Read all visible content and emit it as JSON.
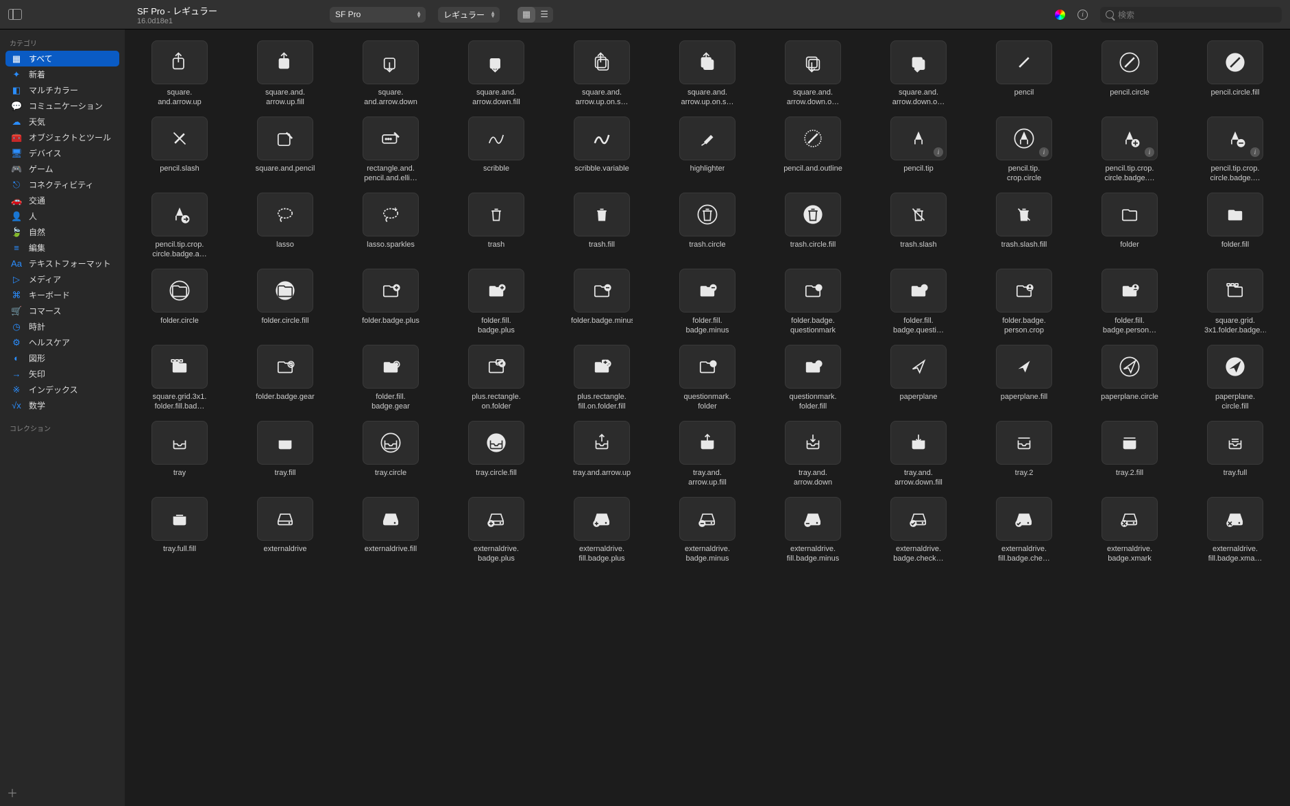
{
  "header": {
    "title": "SF Pro - レギュラー",
    "subtitle": "16.0d18e1",
    "font_select": "SF Pro",
    "weight_select": "レギュラー",
    "search_placeholder": "検索"
  },
  "sidebar": {
    "section_categories": "カテゴリ",
    "section_collections": "コレクション",
    "items": [
      {
        "icon": "grid",
        "label": "すべて",
        "active": true
      },
      {
        "icon": "sparkle",
        "label": "新着"
      },
      {
        "icon": "palette",
        "label": "マルチカラー"
      },
      {
        "icon": "bubble",
        "label": "コミュニケーション"
      },
      {
        "icon": "cloud",
        "label": "天気"
      },
      {
        "icon": "briefcase",
        "label": "オブジェクトとツール"
      },
      {
        "icon": "display",
        "label": "デバイス"
      },
      {
        "icon": "gamepad",
        "label": "ゲーム"
      },
      {
        "icon": "wifi",
        "label": "コネクティビティ"
      },
      {
        "icon": "car",
        "label": "交通"
      },
      {
        "icon": "person",
        "label": "人"
      },
      {
        "icon": "leaf",
        "label": "自然"
      },
      {
        "icon": "lines",
        "label": "編集"
      },
      {
        "icon": "Aa",
        "label": "テキストフォーマット"
      },
      {
        "icon": "play",
        "label": "メディア"
      },
      {
        "icon": "keyboard",
        "label": "キーボード"
      },
      {
        "icon": "cart",
        "label": "コマース"
      },
      {
        "icon": "clock",
        "label": "時計"
      },
      {
        "icon": "gear",
        "label": "ヘルスケア"
      },
      {
        "icon": "shapes",
        "label": "図形"
      },
      {
        "icon": "arrow",
        "label": "矢印"
      },
      {
        "icon": "index",
        "label": "インデックス"
      },
      {
        "icon": "math",
        "label": "数学"
      }
    ]
  },
  "symbols": [
    {
      "name": "square.and.arrow.up",
      "g": "share"
    },
    {
      "name": "square.and.arrow.up.fill",
      "g": "share-fill"
    },
    {
      "name": "square.and.arrow.down",
      "g": "import"
    },
    {
      "name": "square.and.arrow.down.fill",
      "g": "import-fill"
    },
    {
      "name": "square.and.arrow.up.on.s…",
      "g": "share-multi"
    },
    {
      "name": "square.and.arrow.up.on.s…",
      "g": "share-multi-fill"
    },
    {
      "name": "square.and.arrow.down.o…",
      "g": "import-multi"
    },
    {
      "name": "square.and.arrow.down.o…",
      "g": "import-multi-fill"
    },
    {
      "name": "pencil",
      "g": "pencil"
    },
    {
      "name": "pencil.circle",
      "g": "pencil-circle"
    },
    {
      "name": "pencil.circle.fill",
      "g": "pencil-circle-fill"
    },
    {
      "name": "pencil.slash",
      "g": "pencil-slash"
    },
    {
      "name": "square.and.pencil",
      "g": "compose"
    },
    {
      "name": "rectangle.and.pencil.and.elli…",
      "g": "rect-pencil"
    },
    {
      "name": "scribble",
      "g": "scribble"
    },
    {
      "name": "scribble.variable",
      "g": "scribble-var"
    },
    {
      "name": "highlighter",
      "g": "highlighter"
    },
    {
      "name": "pencil.and.outline",
      "g": "pencil-outline"
    },
    {
      "name": "pencil.tip",
      "g": "pencil-tip",
      "info": true
    },
    {
      "name": "pencil.tip.crop.circle",
      "g": "pencil-tip-circle",
      "info": true
    },
    {
      "name": "pencil.tip.crop.circle.badge.…",
      "g": "pencil-tip-badge-plus",
      "info": true
    },
    {
      "name": "pencil.tip.crop.circle.badge.…",
      "g": "pencil-tip-badge-minus",
      "info": true
    },
    {
      "name": "pencil.tip.crop.circle.badge.a…",
      "g": "pencil-tip-badge-arrow"
    },
    {
      "name": "lasso",
      "g": "lasso"
    },
    {
      "name": "lasso.sparkles",
      "g": "lasso-sparkles"
    },
    {
      "name": "trash",
      "g": "trash"
    },
    {
      "name": "trash.fill",
      "g": "trash-fill"
    },
    {
      "name": "trash.circle",
      "g": "trash-circle"
    },
    {
      "name": "trash.circle.fill",
      "g": "trash-circle-fill"
    },
    {
      "name": "trash.slash",
      "g": "trash-slash"
    },
    {
      "name": "trash.slash.fill",
      "g": "trash-slash-fill"
    },
    {
      "name": "folder",
      "g": "folder"
    },
    {
      "name": "folder.fill",
      "g": "folder-fill"
    },
    {
      "name": "folder.circle",
      "g": "folder-circle"
    },
    {
      "name": "folder.circle.fill",
      "g": "folder-circle-fill"
    },
    {
      "name": "folder.badge.plus",
      "g": "folder-plus"
    },
    {
      "name": "folder.fill.badge.plus",
      "g": "folder-fill-plus"
    },
    {
      "name": "folder.badge.minus",
      "g": "folder-minus"
    },
    {
      "name": "folder.fill.badge.minus",
      "g": "folder-fill-minus"
    },
    {
      "name": "folder.badge.questionmark",
      "g": "folder-q"
    },
    {
      "name": "folder.fill.badge.questi…",
      "g": "folder-fill-q"
    },
    {
      "name": "folder.badge.person.crop",
      "g": "folder-person"
    },
    {
      "name": "folder.fill.badge.person…",
      "g": "folder-fill-person"
    },
    {
      "name": "square.grid.3x1.folder.badge.…",
      "g": "grid-folder"
    },
    {
      "name": "square.grid.3x1.folder.fill.bad…",
      "g": "grid-folder-fill"
    },
    {
      "name": "folder.badge.gear",
      "g": "folder-gear"
    },
    {
      "name": "folder.fill.badge.gear",
      "g": "folder-fill-gear"
    },
    {
      "name": "plus.rectangle.on.folder",
      "g": "plus-rect-folder"
    },
    {
      "name": "plus.rectangle.fill.on.folder.fill",
      "g": "plus-rect-folder-fill"
    },
    {
      "name": "questionmark.folder",
      "g": "q-folder"
    },
    {
      "name": "questionmark.folder.fill",
      "g": "q-folder-fill"
    },
    {
      "name": "paperplane",
      "g": "paperplane"
    },
    {
      "name": "paperplane.fill",
      "g": "paperplane-fill"
    },
    {
      "name": "paperplane.circle",
      "g": "paperplane-circle"
    },
    {
      "name": "paperplane.circle.fill",
      "g": "paperplane-circle-fill"
    },
    {
      "name": "tray",
      "g": "tray"
    },
    {
      "name": "tray.fill",
      "g": "tray-fill"
    },
    {
      "name": "tray.circle",
      "g": "tray-circle"
    },
    {
      "name": "tray.circle.fill",
      "g": "tray-circle-fill"
    },
    {
      "name": "tray.and.arrow.up",
      "g": "tray-up"
    },
    {
      "name": "tray.and.arrow.up.fill",
      "g": "tray-up-fill"
    },
    {
      "name": "tray.and.arrow.down",
      "g": "tray-down"
    },
    {
      "name": "tray.and.arrow.down.fill",
      "g": "tray-down-fill"
    },
    {
      "name": "tray.2",
      "g": "tray2"
    },
    {
      "name": "tray.2.fill",
      "g": "tray2-fill"
    },
    {
      "name": "tray.full",
      "g": "tray-full"
    },
    {
      "name": "tray.full.fill",
      "g": "tray-full-fill"
    },
    {
      "name": "externaldrive",
      "g": "drive"
    },
    {
      "name": "externaldrive.fill",
      "g": "drive-fill"
    },
    {
      "name": "externaldrive.badge.plus",
      "g": "drive-plus"
    },
    {
      "name": "externaldrive.fill.badge.plus",
      "g": "drive-fill-plus"
    },
    {
      "name": "externaldrive.badge.minus",
      "g": "drive-minus"
    },
    {
      "name": "externaldrive.fill.badge.minus",
      "g": "drive-fill-minus"
    },
    {
      "name": "externaldrive.badge.check…",
      "g": "drive-check"
    },
    {
      "name": "externaldrive.fill.badge.che…",
      "g": "drive-fill-check"
    },
    {
      "name": "externaldrive.badge.xmark",
      "g": "drive-x"
    },
    {
      "name": "externaldrive.fill.badge.xma…",
      "g": "drive-fill-x"
    }
  ]
}
